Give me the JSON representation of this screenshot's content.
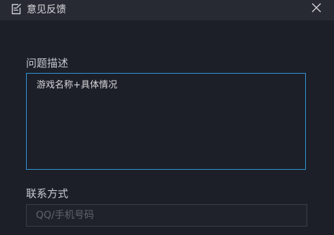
{
  "window": {
    "title": "意见反馈",
    "title_icon": "edit-note-icon",
    "close_icon": "close-icon"
  },
  "form": {
    "description_label": "问题描述",
    "description_value": "游戏名称+具体情况",
    "contact_label": "联系方式",
    "contact_placeholder": "QQ/手机号码"
  },
  "colors": {
    "background": "#1c1f28",
    "titlebar": "#282a33",
    "accent_border": "#2f96d8",
    "input_border": "#3a3e49"
  }
}
